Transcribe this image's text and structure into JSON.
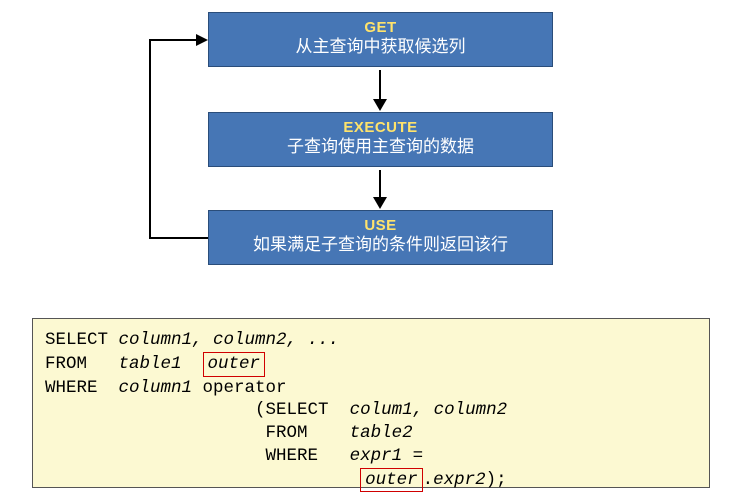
{
  "flow": {
    "box1": {
      "title": "GET",
      "desc": "从主查询中获取候选列"
    },
    "box2": {
      "title": "EXECUTE",
      "desc": "子查询使用主查询的数据"
    },
    "box3": {
      "title": "USE",
      "desc": "如果满足子查询的条件则返回该行"
    }
  },
  "code": {
    "line1_kw": "SELECT ",
    "line1_rest": "column1, column2, ...",
    "line2_kw": "FROM   ",
    "line2_tbl": "table1 ",
    "line2_outer": "outer",
    "line3_kw": "WHERE  ",
    "line3_col": "column1",
    "line3_op": " operator",
    "line4_pad": "                    (",
    "line4_kw": "SELECT  ",
    "line4_cols": "colum1, column2",
    "line5_pad": "                     ",
    "line5_kw": "FROM    ",
    "line5_tbl": "table2",
    "line6_pad": "                     ",
    "line6_kw": "WHERE   ",
    "line6_expr": "expr1 =",
    "line7_pad": "                              ",
    "line7_outer": "outer",
    "line7_dot": ".",
    "line7_expr2": "expr2",
    "line7_end": ");"
  }
}
